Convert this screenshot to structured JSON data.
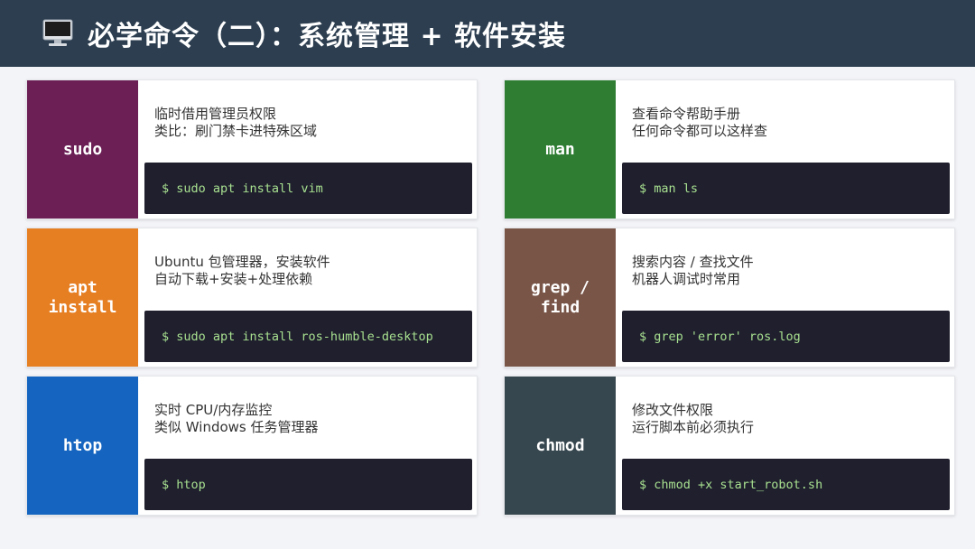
{
  "header": {
    "title": "必学命令（二）：系统管理 + 软件安装",
    "icon": "desktop-computer-icon"
  },
  "cards": [
    {
      "label": "sudo",
      "color": "#6b1f55",
      "line1": "临时借用管理员权限",
      "line2": "类比：刷门禁卡进特殊区域",
      "code": "$ sudo apt install vim"
    },
    {
      "label": "man",
      "color": "#2e7d32",
      "line1": "查看命令帮助手册",
      "line2": "任何命令都可以这样查",
      "code": "$ man ls"
    },
    {
      "label": "apt\ninstall",
      "color": "#e67e22",
      "line1": "Ubuntu 包管理器，安装软件",
      "line2": "自动下载+安装+处理依赖",
      "code": "$ sudo apt install ros-humble-desktop"
    },
    {
      "label": "grep /\nfind",
      "color": "#795548",
      "line1": "搜索内容 / 查找文件",
      "line2": "机器人调试时常用",
      "code": "$ grep 'error' ros.log"
    },
    {
      "label": "htop",
      "color": "#1565c0",
      "line1": "实时 CPU/内存监控",
      "line2": "类似 Windows 任务管理器",
      "code": "$ htop"
    },
    {
      "label": "chmod",
      "color": "#37474f",
      "line1": "修改文件权限",
      "line2": "运行脚本前必须执行",
      "code": "$ chmod +x start_robot.sh"
    }
  ]
}
